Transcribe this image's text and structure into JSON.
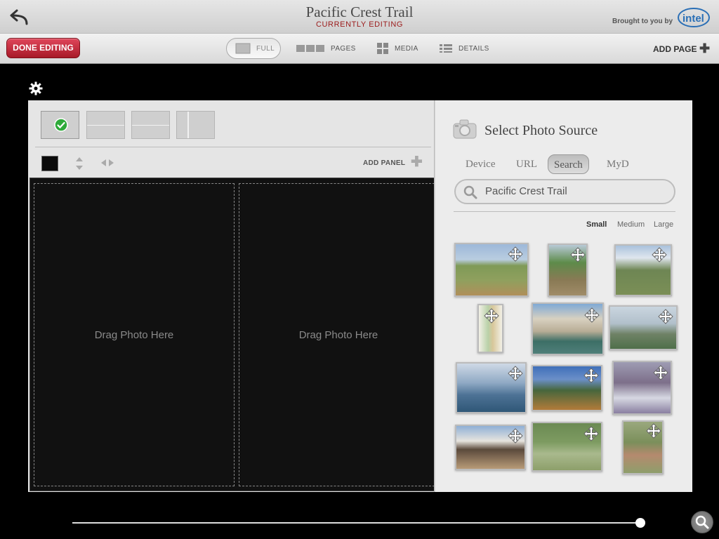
{
  "header": {
    "title": "Pacific Crest Trail",
    "subtitle": "CURRENTLY EDITING",
    "brought_by": "Brought to you by",
    "brand": "intel"
  },
  "toolbar": {
    "done_label": "DONE EDITING",
    "views": [
      {
        "label": "FULL",
        "active": true
      },
      {
        "label": "PAGES",
        "active": false
      },
      {
        "label": "MEDIA",
        "active": false
      },
      {
        "label": "DETAILS",
        "active": false
      }
    ],
    "add_page_label": "ADD PAGE"
  },
  "editor": {
    "add_panel_label": "ADD PANEL",
    "drop_zones": [
      "Drag Photo Here",
      "Drag Photo Here"
    ]
  },
  "photo_source": {
    "title": "Select Photo Source",
    "tabs": [
      {
        "label": "Device",
        "active": false
      },
      {
        "label": "URL",
        "active": false
      },
      {
        "label": "Search",
        "active": true
      },
      {
        "label": "MyD",
        "active": false
      }
    ],
    "search_value": "Pacific Crest Trail",
    "sizes": [
      {
        "label": "Small",
        "active": true
      },
      {
        "label": "Medium",
        "active": false
      },
      {
        "label": "Large",
        "active": false
      }
    ]
  },
  "colors": {
    "accent_red": "#b8202f",
    "subtitle_red": "#9b1b1b",
    "check_green": "#2eaa3a"
  }
}
